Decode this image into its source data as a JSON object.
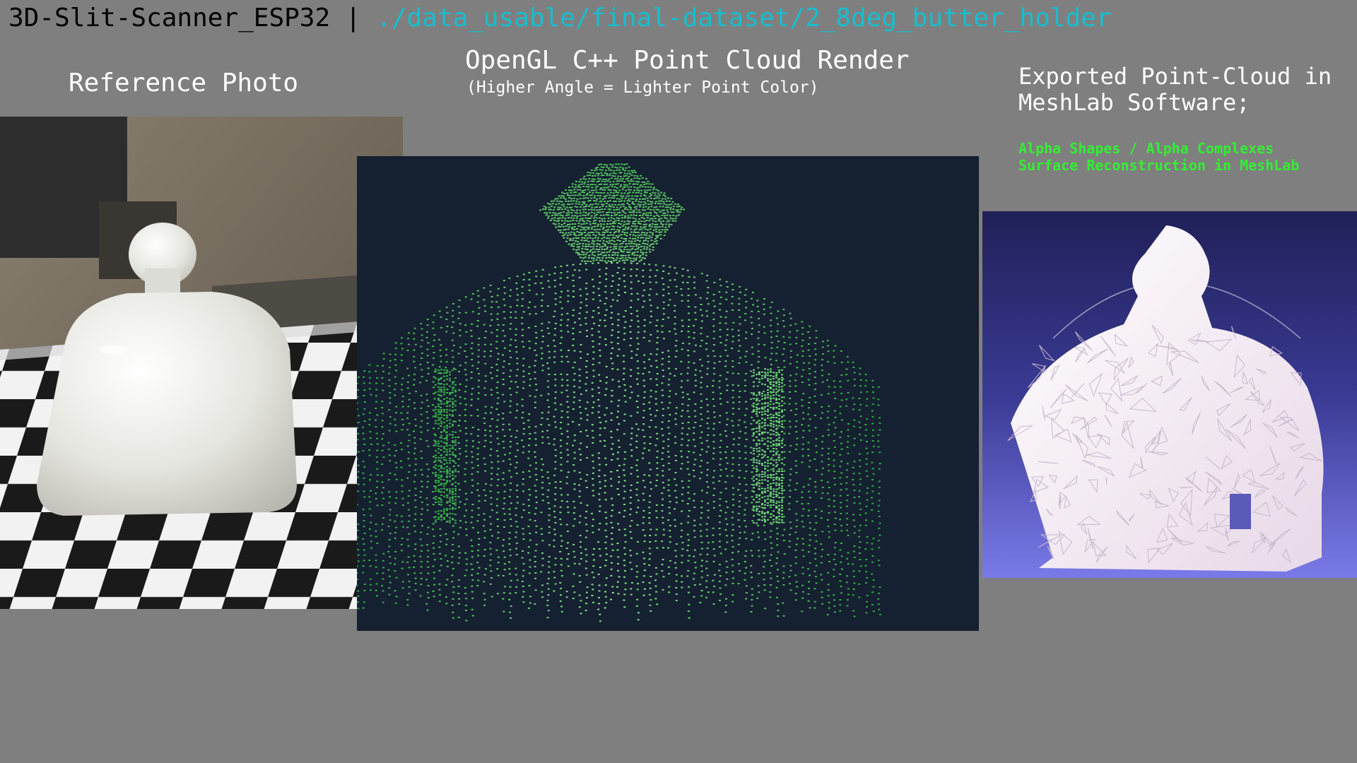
{
  "header": {
    "project": "3D-Slit-Scanner_ESP32",
    "separator": "|",
    "path": "./data_usable/final-dataset/2_8deg_butter_holder"
  },
  "panels": {
    "reference": {
      "title": "Reference Photo"
    },
    "opengl": {
      "title": "OpenGL C++ Point Cloud Render",
      "subtitle": "(Higher Angle = Lighter Point Color)"
    },
    "meshlab": {
      "title": "Exported Point-Cloud in\nMeshLab Software;",
      "subtitle": "Alpha Shapes / Alpha Complexes\nSurface Reconstruction in MeshLab"
    }
  },
  "colors": {
    "background": "#7f7f7f",
    "path": "#17becf",
    "accent_green": "#33ee33",
    "render_bg": "#152030"
  }
}
